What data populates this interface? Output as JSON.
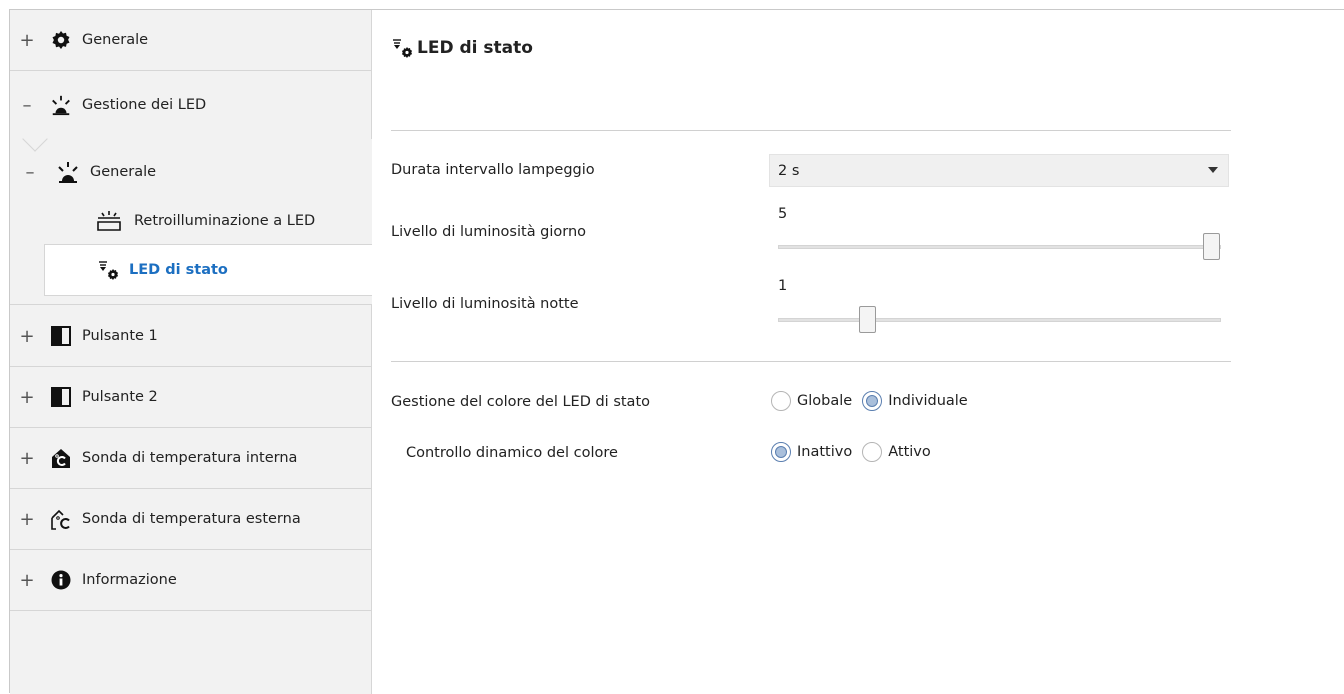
{
  "sidebar": {
    "items": [
      {
        "toggle": "+",
        "label": "Generale",
        "icon": "gear-icon"
      },
      {
        "toggle": "–",
        "label": "Gestione dei LED",
        "icon": "led-lamp-icon"
      },
      {
        "toggle": "+",
        "label": "Pulsante 1",
        "icon": "pushbutton-icon"
      },
      {
        "toggle": "+",
        "label": "Pulsante 2",
        "icon": "pushbutton-icon"
      },
      {
        "toggle": "+",
        "label": "Sonda di temperatura interna",
        "icon": "house-temperature-icon"
      },
      {
        "toggle": "+",
        "label": "Sonda di temperatura esterna",
        "icon": "house-outline-temperature-icon"
      },
      {
        "toggle": "+",
        "label": "Informazione",
        "icon": "info-icon"
      }
    ],
    "sub_group": {
      "toggle": "–",
      "label": "Generale",
      "icon": "led-lamp-icon",
      "children": [
        {
          "label": "Retroilluminazione a LED",
          "icon": "backlight-icon"
        },
        {
          "label": "LED di stato",
          "icon": "status-led-icon",
          "selected": true
        }
      ]
    }
  },
  "main": {
    "title": "LED di stato",
    "rows": {
      "flash_interval": {
        "label": "Durata intervallo lampeggio",
        "value": "2 s"
      },
      "brightness_day": {
        "label": "Livello di luminosità giorno",
        "value": "5",
        "level": 5,
        "min": 1,
        "max": 5
      },
      "brightness_night": {
        "label": "Livello di luminosità notte",
        "value": "1",
        "level": 1,
        "min": 1,
        "max": 5
      },
      "color_management": {
        "label": "Gestione del colore del LED di stato",
        "options": [
          "Globale",
          "Individuale"
        ],
        "selected": "Individuale"
      },
      "dynamic_color": {
        "label": "Controllo dinamico del colore",
        "options": [
          "Inattivo",
          "Attivo"
        ],
        "selected": "Inattivo"
      }
    }
  },
  "colors": {
    "accent": "#1c6fc1",
    "sidebar_bg": "#f2f2f2",
    "radio_selected": "#a9bfdb"
  }
}
